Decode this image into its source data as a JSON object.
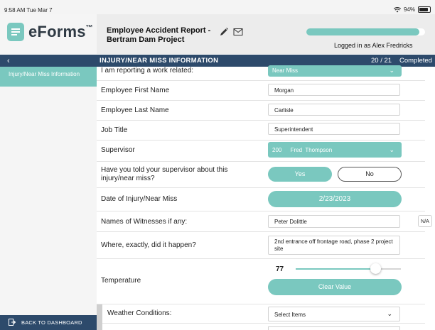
{
  "status_bar": {
    "time": "9:58 AM  Tue Mar 7",
    "battery": "94%"
  },
  "app": {
    "logo_text": "eForms",
    "logo_tm": "™"
  },
  "header": {
    "title": "Employee Accident Report - Bertram Dam Project",
    "logged_in": "Logged in as Alex Fredricks",
    "progress": 0.95
  },
  "section": {
    "title": "INJURY/NEAR MISS INFORMATION",
    "count": "20 / 21",
    "status": "Completed",
    "back": "‹"
  },
  "sidebar": {
    "items": [
      {
        "label": "Injury/Near Miss Information"
      }
    ],
    "footer": "BACK TO DASHBOARD"
  },
  "form": {
    "reporting_label": "I am reporting a work related:",
    "reporting_value": "Near Miss",
    "first_name_label": "Employee First Name",
    "first_name_value": "Morgan",
    "last_name_label": "Employee Last Name",
    "last_name_value": "Carlisle",
    "job_title_label": "Job Title",
    "job_title_value": "Superintendent",
    "supervisor_label": "Supervisor",
    "supervisor_id": "200",
    "supervisor_name": "Fred  Thompson",
    "told_label": "Have you told your supervisor about this injury/near miss?",
    "yes_label": "Yes",
    "no_label": "No",
    "date_label": "Date of Injury/Near Miss",
    "date_value": "2/23/2023",
    "witnesses_label": "Names of Witnesses if any:",
    "witnesses_value": "Peter Dolittle",
    "na_label": "N/A",
    "where_label": "Where, exactly, did it happen?",
    "where_value": "2nd entrance off frontage road, phase 2 project site",
    "temperature_label": "Temperature",
    "temperature_value": "77",
    "temperature_slider": 0.76,
    "clear_label": "Clear Value",
    "weather_label": "Weather Conditions:",
    "weather_placeholder": "Select Items"
  },
  "colors": {
    "teal": "#7ac8bf",
    "navy": "#2d4a6b",
    "accent_border": "#b9dfc0"
  }
}
